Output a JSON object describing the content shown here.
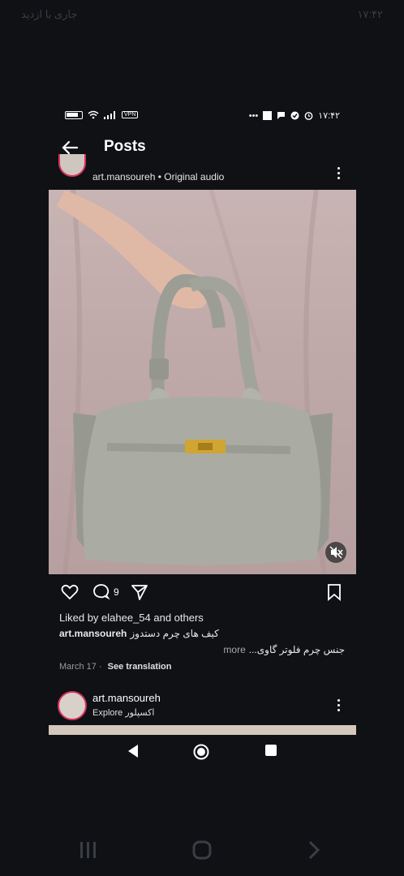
{
  "outer_status": {
    "left_text": "جاری با ازدید",
    "right_text": "۱۷:۴۲"
  },
  "inner_status": {
    "vpn": "VPN",
    "time": "۱۷:۴۲"
  },
  "header": {
    "title": "Posts"
  },
  "post": {
    "user_line": "art.mansoureh • Original audio",
    "comment_count": "9",
    "likes": "Liked by elahee_54 and others",
    "caption_user": "art.mansoureh",
    "caption_text": "کیف های چرم دستدوز",
    "caption_line2": "جنس چرم فلوتر گاوی...",
    "more": "more",
    "date": "March 17",
    "see_translation": "See translation"
  },
  "next_post": {
    "username": "art.mansoureh",
    "subtitle": "Explore اکسپلور"
  },
  "colors": {
    "bg": "#0f1115",
    "story_ring": "#d8325c",
    "bag": "#a8aaa2",
    "clasp": "#d0a531"
  }
}
